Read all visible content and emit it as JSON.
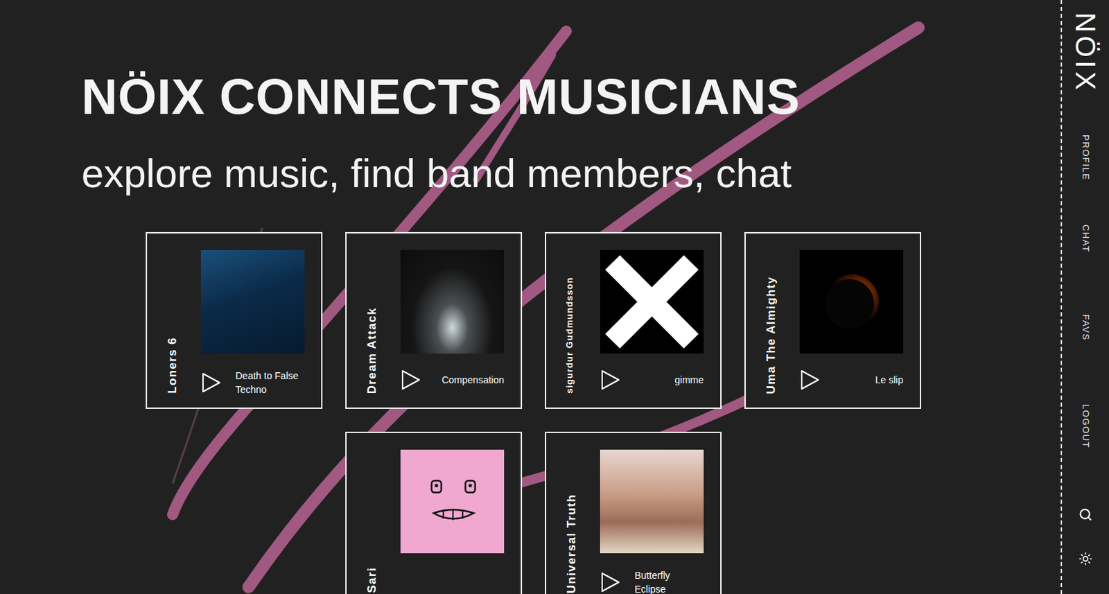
{
  "logo": "NÖIX",
  "hero": {
    "title": "NÖIX CONNECTS MUSICIANS",
    "subtitle": "explore music, find band members, chat"
  },
  "nav": [
    {
      "label": "PROFILE"
    },
    {
      "label": "CHAT"
    },
    {
      "label": "FAVS"
    },
    {
      "label": "LOGOUT"
    }
  ],
  "cards": [
    {
      "artist": "Loners 6",
      "song": "Death to False Techno"
    },
    {
      "artist": "Dream Attack",
      "song": "Compensation"
    },
    {
      "artist": "sigurdur Gudmundsson",
      "song": "gimme"
    },
    {
      "artist": "Uma The Almighty",
      "song": "Le slip"
    },
    {
      "artist": "Sari"
    },
    {
      "artist": "Universal Truth",
      "song": "Butterfly Eclipse"
    }
  ]
}
